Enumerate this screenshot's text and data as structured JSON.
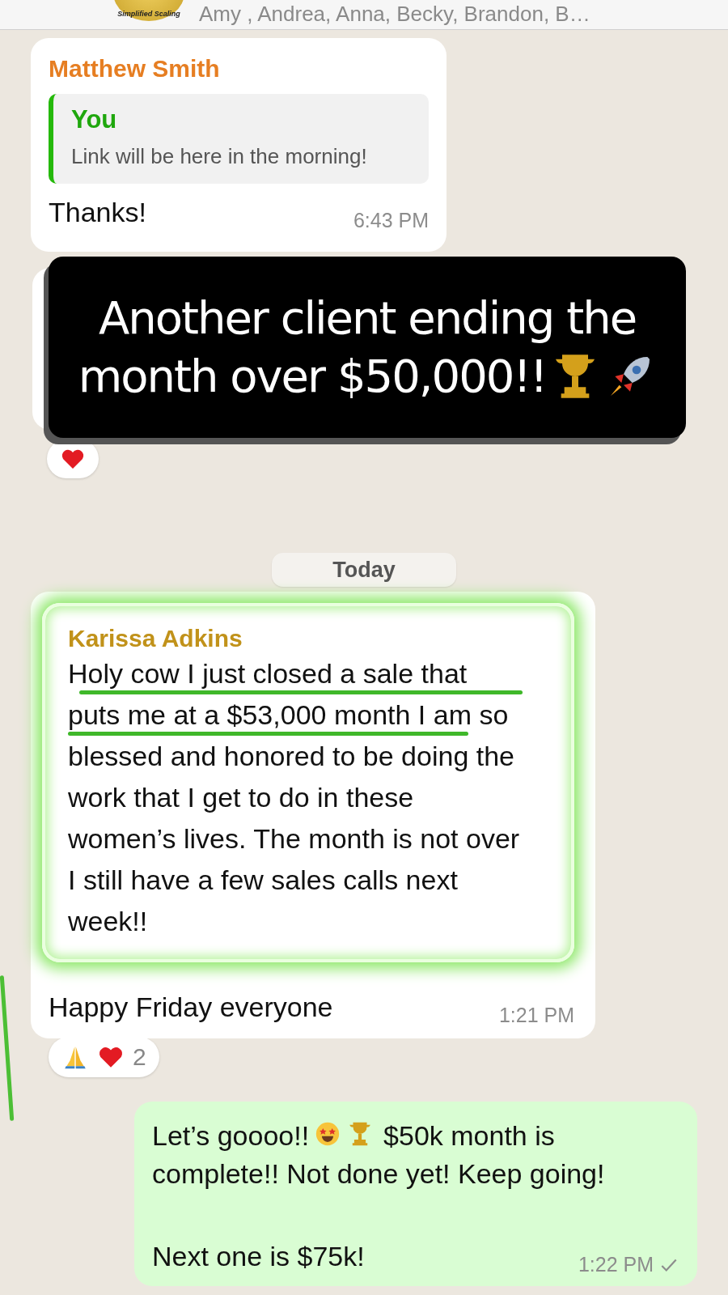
{
  "header": {
    "avatar_text": "Simplified Scaling",
    "members": "Amy , Andrea, Anna, Becky, Brandon, B…"
  },
  "messages": [
    {
      "kind": "reply",
      "sender": "Matthew Smith",
      "quote_sender": "You",
      "quote_text": "Link will be here in the morning!",
      "text": "Thanks!",
      "time": "6:43 PM"
    },
    {
      "kind": "covered",
      "banner_lines": [
        "Another client ending the",
        "month over $50,000!!"
      ]
    },
    {
      "kind": "date",
      "text": "Today"
    },
    {
      "kind": "highlighted",
      "sender": "Karissa Adkins",
      "lines": [
        {
          "text": "Holy cow I just closed a sale that",
          "underlined": true
        },
        {
          "text": "puts me at a $53,000 month I am so",
          "underlined": true
        },
        {
          "text": "blessed and honored to be doing the",
          "underlined": false
        },
        {
          "text": "work that I get to do in these",
          "underlined": false
        },
        {
          "text": "women’s lives. The month is not over",
          "underlined": false
        },
        {
          "text": "I still have a few sales calls next",
          "underlined": false
        },
        {
          "text": "week!!",
          "underlined": false
        }
      ],
      "text2": "Happy Friday everyone",
      "time": "1:21 PM",
      "reaction_count": "2"
    },
    {
      "kind": "outgoing",
      "text_before": "Let’s goooo!!",
      "text_after": "$50k month is",
      "text_line2": "complete!! Not done yet! Keep going!",
      "text2": "Next one is $75k!",
      "time": "1:22 PM",
      "delivered": true
    }
  ]
}
